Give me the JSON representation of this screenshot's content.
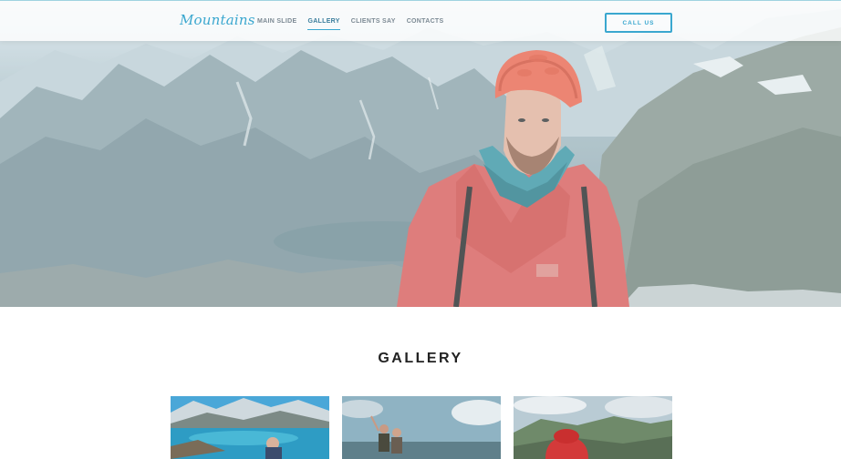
{
  "header": {
    "logo": "Mountains",
    "nav": [
      {
        "label": "MAIN SLIDE",
        "active": false
      },
      {
        "label": "GALLERY",
        "active": true
      },
      {
        "label": "CLIENTS SAY",
        "active": false
      },
      {
        "label": "CONTACTS",
        "active": false
      }
    ],
    "call_label": "CALL US"
  },
  "gallery": {
    "title": "GALLERY"
  },
  "colors": {
    "accent": "#3aa7cf",
    "jacket": "#e0605e",
    "helmet": "#f26b52"
  }
}
